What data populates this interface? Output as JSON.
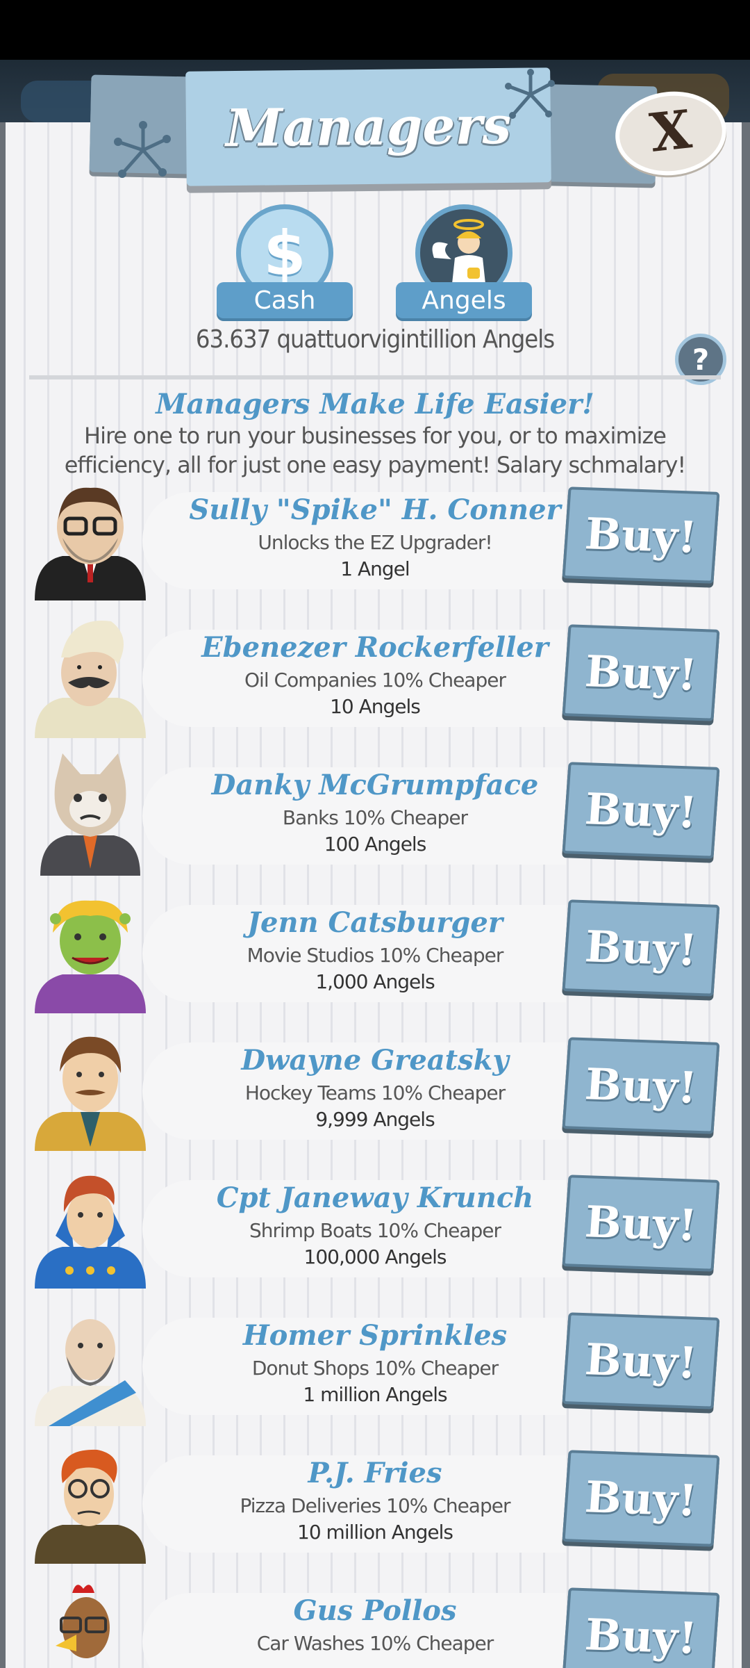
{
  "header": {
    "title": "Managers",
    "close_label": "X",
    "help_label": "?"
  },
  "tabs": [
    {
      "label": "Cash",
      "icon": "dollar-coin-icon",
      "symbol": "$"
    },
    {
      "label": "Angels",
      "icon": "angel-icon"
    }
  ],
  "angels_count": "63.637 quattuorvigintillion Angels",
  "promo": {
    "title": "Managers Make Life Easier!",
    "text": "Hire one to run your businesses for you, or to maximize efficiency, all for just one easy payment! Salary schmalary!"
  },
  "managers": [
    {
      "name": "Sully \"Spike\" H. Conner",
      "desc": "Unlocks the EZ Upgrader!",
      "cost": "1 Angel",
      "button": "Buy!"
    },
    {
      "name": "Ebenezer Rockerfeller",
      "desc": "Oil Companies 10% Cheaper",
      "cost": "10 Angels",
      "button": "Buy!"
    },
    {
      "name": "Danky McGrumpface",
      "desc": "Banks 10% Cheaper",
      "cost": "100 Angels",
      "button": "Buy!"
    },
    {
      "name": "Jenn Catsburger",
      "desc": "Movie Studios 10% Cheaper",
      "cost": "1,000 Angels",
      "button": "Buy!"
    },
    {
      "name": "Dwayne Greatsky",
      "desc": "Hockey Teams 10% Cheaper",
      "cost": "9,999 Angels",
      "button": "Buy!"
    },
    {
      "name": "Cpt Janeway Krunch",
      "desc": "Shrimp Boats 10% Cheaper",
      "cost": "100,000 Angels",
      "button": "Buy!"
    },
    {
      "name": "Homer Sprinkles",
      "desc": "Donut Shops 10% Cheaper",
      "cost": "1 million Angels",
      "button": "Buy!"
    },
    {
      "name": "P.J. Fries",
      "desc": "Pizza Deliveries 10% Cheaper",
      "cost": "10 million Angels",
      "button": "Buy!"
    },
    {
      "name": "Gus Pollos",
      "desc": "Car Washes 10% Cheaper",
      "cost": "",
      "button": "Buy!"
    }
  ],
  "colors": {
    "accent_blue": "#4f97c7",
    "button_blue": "#8fb5cf",
    "panel_bg": "#f3f3f5",
    "banner_blue": "#aed0e5"
  }
}
